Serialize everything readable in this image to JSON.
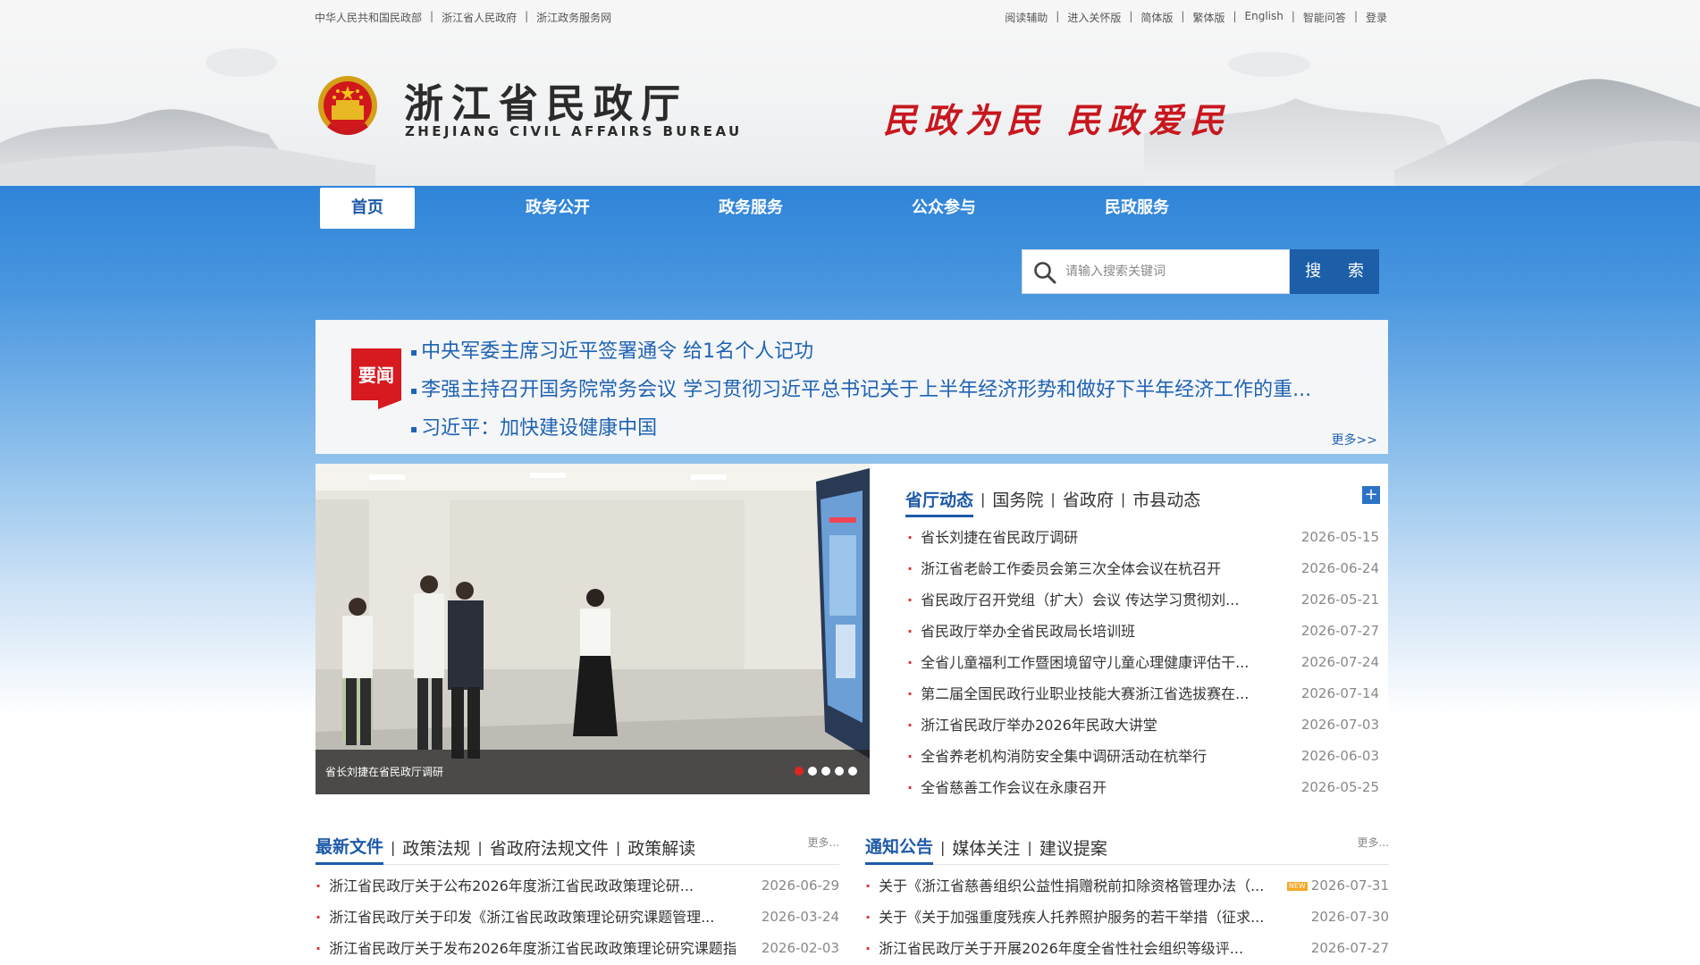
{
  "topbar": {
    "left_links": [
      "中华人民共和国民政部",
      "浙江省人民政府",
      "浙江政务服务网"
    ],
    "right_links": [
      "阅读辅助",
      "进入关怀版",
      "简体版",
      "繁体版",
      "English",
      "智能问答",
      "登录"
    ]
  },
  "header": {
    "title_cn": "浙江省民政厅",
    "title_en": "ZHEJIANG CIVIL AFFAIRS BUREAU",
    "slogan": "民政为民 民政爱民"
  },
  "nav": {
    "items": [
      "首页",
      "政务公开",
      "政务服务",
      "公众参与",
      "民政服务"
    ],
    "active_index": 0
  },
  "search": {
    "placeholder": "请输入搜索关键词",
    "button_label": "搜 索"
  },
  "headlines": {
    "badge": "要闻",
    "items": [
      "中央军委主席习近平签署通令 给1名个人记功",
      "李强主持召开国务院常务会议 学习贯彻习近平总书记关于上半年经济形势和做好下半年经济工作的重...",
      "习近平：加快建设健康中国"
    ],
    "more": "更多>>"
  },
  "slider": {
    "caption": "省长刘捷在省民政厅调研",
    "slide_count": 5,
    "active_slide": 0
  },
  "news_panel": {
    "tabs": [
      "省厅动态",
      "国务院",
      "省政府",
      "市县动态"
    ],
    "active_tab": 0,
    "plus": "+",
    "rows": [
      {
        "title": "省长刘捷在省民政厅调研",
        "date": "2026-05-15"
      },
      {
        "title": "浙江省老龄工作委员会第三次全体会议在杭召开",
        "date": "2026-06-24"
      },
      {
        "title": "省民政厅召开党组（扩大）会议 传达学习贯彻刘...",
        "date": "2026-05-21"
      },
      {
        "title": "省民政厅举办全省民政局长培训班",
        "date": "2026-07-27"
      },
      {
        "title": "全省儿童福利工作暨困境留守儿童心理健康评估干...",
        "date": "2026-07-24"
      },
      {
        "title": "第二届全国民政行业职业技能大赛浙江省选拔赛在...",
        "date": "2026-07-14"
      },
      {
        "title": "浙江省民政厅举办2026年民政大讲堂",
        "date": "2026-07-03"
      },
      {
        "title": "全省养老机构消防安全集中调研活动在杭举行",
        "date": "2026-06-03"
      },
      {
        "title": "全省慈善工作会议在永康召开",
        "date": "2026-05-25"
      }
    ]
  },
  "files_column": {
    "tabs": [
      "最新文件",
      "政策法规",
      "省政府法规文件",
      "政策解读"
    ],
    "active_tab": 0,
    "more": "更多...",
    "rows": [
      {
        "title": "浙江省民政厅关于公布2026年度浙江省民政政策理论研...",
        "date": "2026-06-29"
      },
      {
        "title": "浙江省民政厅关于印发《浙江省民政政策理论研究课题管理...",
        "date": "2026-03-24"
      },
      {
        "title": "浙江省民政厅关于发布2026年度浙江省民政政策理论研究课题指...",
        "date": "2026-02-03"
      }
    ]
  },
  "notice_column": {
    "tabs": [
      "通知公告",
      "媒体关注",
      "建议提案"
    ],
    "active_tab": 0,
    "more": "更多...",
    "new_badge": "NEW",
    "rows": [
      {
        "title": "关于《浙江省慈善组织公益性捐赠税前扣除资格管理办法（...",
        "date": "2026-07-31",
        "is_new": true
      },
      {
        "title": "关于《关于加强重度残疾人托养照护服务的若干举措（征求...",
        "date": "2026-07-30",
        "is_new": false
      },
      {
        "title": "浙江省民政厅关于开展2026年度全省性社会组织等级评...",
        "date": "2026-07-27",
        "is_new": false
      }
    ]
  },
  "colors": {
    "primary_blue": "#1e5aa8",
    "link_blue": "#1e63b3",
    "accent_red": "#c8171e",
    "band_top": "#2f84d8"
  }
}
